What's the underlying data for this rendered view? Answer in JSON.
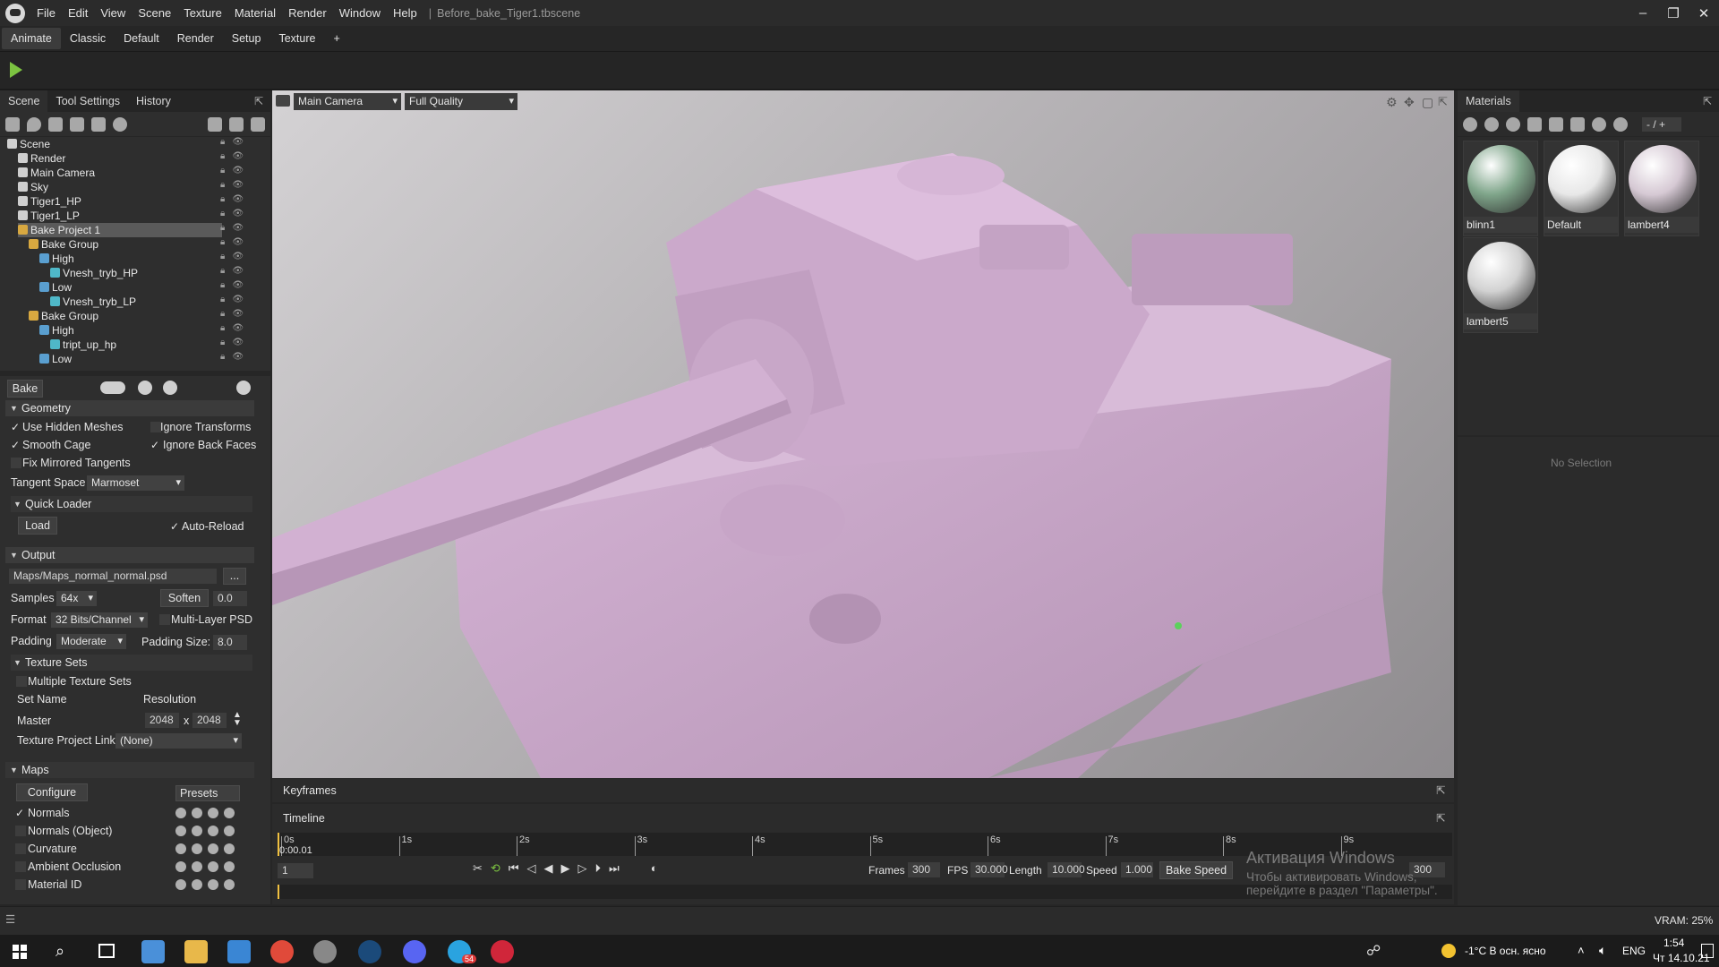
{
  "app": {
    "menu": [
      "File",
      "Edit",
      "View",
      "Scene",
      "Texture",
      "Material",
      "Render",
      "Window",
      "Help"
    ],
    "document": "Before_bake_Tiger1.tbscene",
    "window_buttons": [
      "–",
      "❐",
      "✕"
    ]
  },
  "layout_tabs": [
    "Animate",
    "Classic",
    "Default",
    "Render",
    "Setup",
    "Texture",
    "+"
  ],
  "left_panel": {
    "tabs": [
      "Scene",
      "Tool Settings",
      "History"
    ],
    "tree": [
      {
        "label": "Scene",
        "indent": 0
      },
      {
        "label": "Render",
        "indent": 1
      },
      {
        "label": "Main Camera",
        "indent": 1
      },
      {
        "label": "Sky",
        "indent": 1
      },
      {
        "label": "Tiger1_HP",
        "indent": 1
      },
      {
        "label": "Tiger1_LP",
        "indent": 1
      },
      {
        "label": "Bake Project 1",
        "indent": 1,
        "selected": true
      },
      {
        "label": "Bake Group",
        "indent": 2
      },
      {
        "label": "High",
        "indent": 3
      },
      {
        "label": "Vnesh_tryb_HP",
        "indent": 4
      },
      {
        "label": "Low",
        "indent": 3
      },
      {
        "label": "Vnesh_tryb_LP",
        "indent": 4
      },
      {
        "label": "Bake Group",
        "indent": 2
      },
      {
        "label": "High",
        "indent": 3
      },
      {
        "label": "tript_up_hp",
        "indent": 4
      },
      {
        "label": "Low",
        "indent": 3
      }
    ]
  },
  "bake": {
    "title": "Bake",
    "geometry": {
      "header": "Geometry",
      "use_hidden_meshes": "Use Hidden Meshes",
      "ignore_transforms": "Ignore Transforms",
      "smooth_cage": "Smooth Cage",
      "ignore_back_faces": "Ignore Back Faces",
      "fix_mirrored": "Fix Mirrored Tangents",
      "tangent_space_label": "Tangent Space",
      "tangent_space_value": "Marmoset",
      "quick_loader": "Quick Loader",
      "load": "Load",
      "auto_reload": "Auto-Reload"
    },
    "output": {
      "header": "Output",
      "path": "Maps/Maps_normal_normal.psd",
      "browse": "...",
      "samples_label": "Samples",
      "samples_value": "64x",
      "soften_label": "Soften",
      "soften_value": "0.0",
      "format_label": "Format",
      "format_value": "32 Bits/Channel",
      "multilayer": "Multi-Layer PSD",
      "padding_label": "Padding",
      "padding_value": "Moderate",
      "padding_size_label": "Padding Size:",
      "padding_size_value": "8.0",
      "texture_sets": "Texture Sets",
      "multiple_sets": "Multiple Texture Sets",
      "set_name": "Set Name",
      "resolution": "Resolution",
      "master": "Master",
      "res_w": "2048",
      "res_x": "x",
      "res_h": "2048",
      "link_label": "Texture Project Link",
      "link_value": "(None)"
    },
    "maps": {
      "header": "Maps",
      "configure": "Configure",
      "presets": "Presets",
      "items": [
        {
          "label": "Normals",
          "checked": true
        },
        {
          "label": "Normals (Object)",
          "checked": false
        },
        {
          "label": "Curvature",
          "checked": false
        },
        {
          "label": "Ambient Occlusion",
          "checked": false
        },
        {
          "label": "Material ID",
          "checked": false
        }
      ]
    }
  },
  "viewport": {
    "camera": "Main Camera",
    "quality": "Full Quality"
  },
  "materials": {
    "title": "Materials",
    "page": "- / +",
    "items": [
      {
        "name": "blinn1",
        "color": "#7fa58a"
      },
      {
        "name": "Default",
        "color": "#e8e8e8"
      },
      {
        "name": "lambert4",
        "color": "#d6c9d4"
      },
      {
        "name": "lambert5",
        "color": "#d2d2d2"
      }
    ],
    "no_selection": "No Selection"
  },
  "keyframes": {
    "title": "Keyframes"
  },
  "timeline": {
    "title": "Timeline",
    "ticks": [
      "0s",
      "1s",
      "2s",
      "3s",
      "4s",
      "5s",
      "6s",
      "7s",
      "8s",
      "9s"
    ],
    "current_time": "0:00.01",
    "frame_field": "1",
    "frames_label": "Frames",
    "frames_value": "300",
    "fps_label": "FPS",
    "fps_value": "30.000",
    "length_label": "Length",
    "length_value": "10.000",
    "speed_label": "Speed",
    "speed_value": "1.000",
    "bake_speed": "Bake Speed",
    "end_frame": "300"
  },
  "status": {
    "vram": "VRAM: 25%"
  },
  "windows_activation": {
    "title": "Активация Windows",
    "text": "Чтобы активировать Windows, перейдите в раздел \"Параметры\"."
  },
  "taskbar": {
    "weather": "-1°C  В осн. ясно",
    "lang": "ENG",
    "time": "1:54",
    "date": "Чт 14.10.21",
    "telegram_badge": "54"
  }
}
